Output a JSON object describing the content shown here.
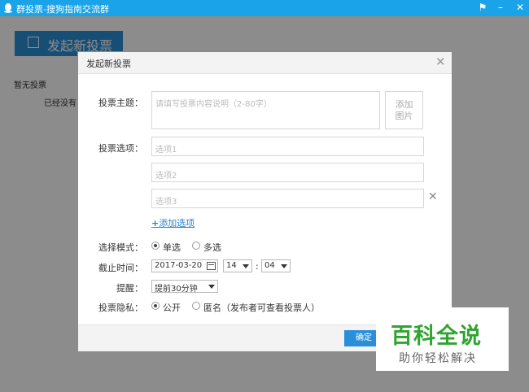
{
  "window": {
    "title": "群投票-搜狗指南交流群"
  },
  "background": {
    "launch_label": "发起新投票",
    "empty_label": "暂无投票",
    "empty_hint": "已经没有"
  },
  "dialog": {
    "title": "发起新投票",
    "topic_label": "投票主题：",
    "topic_placeholder": "请填写投票内容说明（2-80字）",
    "add_image_line1": "添加",
    "add_image_line2": "图片",
    "options_label": "投票选项：",
    "options": [
      "选项1",
      "选项2",
      "选项3"
    ],
    "add_option_label": "添加选项",
    "mode_label": "选择模式：",
    "mode_single": "单选",
    "mode_multi": "多选",
    "deadline_label": "截止时间：",
    "deadline_date": "2017-03-20",
    "deadline_hour": "14",
    "deadline_minute": "04",
    "time_sep": ":",
    "remind_label": "提醒：",
    "remind_value": "提前30分钟",
    "privacy_label": "投票隐私：",
    "privacy_public": "公开",
    "privacy_anon": "匿名（发布者可查看投票人）",
    "confirm_label": "确定"
  },
  "watermark": {
    "main": "百科全说",
    "sub": "助你轻松解决"
  },
  "colors": {
    "titlebar": "#1aa3e8",
    "accent": "#2a8fd8",
    "watermark": "#2fa530"
  }
}
